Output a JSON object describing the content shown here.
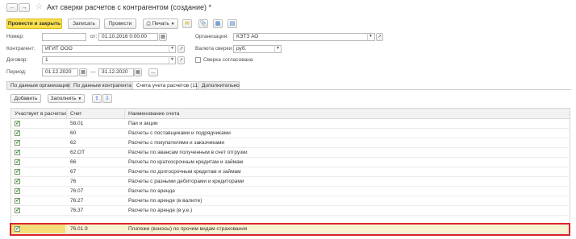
{
  "window": {
    "title": "Акт сверки расчетов с контрагентом (создание) *"
  },
  "toolbar": {
    "post_close": "Провести и закрыть",
    "save": "Записать",
    "post": "Провести",
    "print": "Печать"
  },
  "form": {
    "number_label": "Номер:",
    "number_value": "",
    "date_label": "от:",
    "date_value": "01.10.2016  0:00:00",
    "org_label": "Организация:",
    "org_value": "КЭТЗ АО",
    "counterparty_label": "Контрагент:",
    "counterparty_value": "ИГИТ ООО",
    "currency_label": "Валюта сверки:",
    "currency_value": "руб.",
    "contract_label": "Договор:",
    "contract_value": "1",
    "agreed_label": "Сверка согласована",
    "agreed_checked": false,
    "period_label": "Период:",
    "period_from": "01.12.2020",
    "period_dash": "—",
    "period_to": "31.12.2020",
    "period_more": "..."
  },
  "tabs": [
    {
      "label": "По данным организации",
      "active": false
    },
    {
      "label": "По данным контрагента",
      "active": false
    },
    {
      "label": "Счета учета расчетов (11)",
      "active": true
    },
    {
      "label": "Дополнительно",
      "active": false
    }
  ],
  "grid_toolbar": {
    "add": "Добавить",
    "fill": "Заполнить"
  },
  "grid": {
    "headers": [
      "Участвует в расчетах",
      "Счет",
      "Наименование счета"
    ],
    "rows": [
      {
        "checked": true,
        "account": "58.01",
        "name": "Паи и акции"
      },
      {
        "checked": true,
        "account": "60",
        "name": "Расчеты с поставщиками и подрядчиками"
      },
      {
        "checked": true,
        "account": "62",
        "name": "Расчеты с покупателями и заказчиками"
      },
      {
        "checked": true,
        "account": "62.ОТ",
        "name": "Расчеты по авансам полученным в счет отгрузки"
      },
      {
        "checked": true,
        "account": "66",
        "name": "Расчеты по краткосрочным кредитам и займам"
      },
      {
        "checked": true,
        "account": "67",
        "name": "Расчеты по долгосрочным кредитам и займам"
      },
      {
        "checked": true,
        "account": "76",
        "name": "Расчеты с разными дебиторами и кредиторами"
      },
      {
        "checked": true,
        "account": "76.07",
        "name": "Расчеты по аренде"
      },
      {
        "checked": true,
        "account": "76.27",
        "name": "Расчеты по аренде (в валюте)"
      },
      {
        "checked": true,
        "account": "76.37",
        "name": "Расчеты по аренде (в у.е.)"
      },
      {
        "checked": true,
        "account": "76.01.9",
        "name": "Платежи (взносы) по прочим видам страхования"
      }
    ]
  },
  "colors": {
    "primary_button": "#fce04c",
    "selected_row": "#faf3d1",
    "highlight_border": "#d9252a",
    "check_green": "#2d8a2d"
  }
}
